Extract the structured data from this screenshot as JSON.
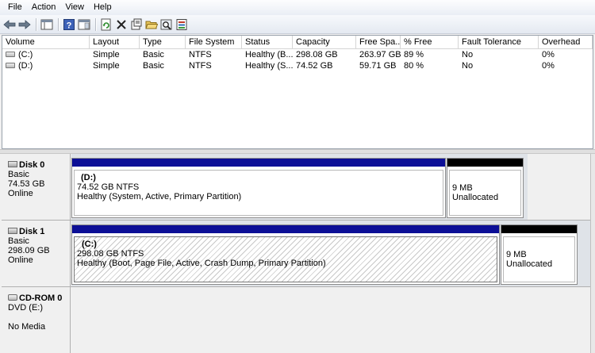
{
  "menu": [
    "File",
    "Action",
    "View",
    "Help"
  ],
  "toolbar": {
    "buttons": [
      "back-icon",
      "forward-icon",
      "show-hide-tree-icon",
      "help-icon",
      "properties-icon",
      "refresh-icon",
      "delete-icon",
      "properties-sheet-icon",
      "open-icon",
      "explore-icon",
      "export-list-icon"
    ]
  },
  "volumes": {
    "columns": [
      "Volume",
      "Layout",
      "Type",
      "File System",
      "Status",
      "Capacity",
      "Free Spa...",
      "% Free",
      "Fault Tolerance",
      "Overhead"
    ],
    "rows": [
      {
        "volume": "(C:)",
        "layout": "Simple",
        "type": "Basic",
        "fs": "NTFS",
        "status": "Healthy (B...",
        "capacity": "298.08 GB",
        "free": "263.97 GB",
        "pct": "89 %",
        "fault": "No",
        "overhead": "0%"
      },
      {
        "volume": "(D:)",
        "layout": "Simple",
        "type": "Basic",
        "fs": "NTFS",
        "status": "Healthy (S...",
        "capacity": "74.52 GB",
        "free": "59.71 GB",
        "pct": "80 %",
        "fault": "No",
        "overhead": "0%"
      }
    ]
  },
  "disks": [
    {
      "name": "Disk 0",
      "type": "Basic",
      "size": "74.53 GB",
      "state": "Online",
      "partitions": [
        {
          "name": "(D:)",
          "size": "74.52 GB NTFS",
          "status": "Healthy (System, Active, Primary Partition)"
        },
        {
          "name": "",
          "size": "9 MB",
          "status": "Unallocated"
        }
      ]
    },
    {
      "name": "Disk 1",
      "type": "Basic",
      "size": "298.09 GB",
      "state": "Online",
      "partitions": [
        {
          "name": "(C:)",
          "size": "298.08 GB NTFS",
          "status": "Healthy (Boot, Page File, Active, Crash Dump, Primary Partition)"
        },
        {
          "name": "",
          "size": "9 MB",
          "status": "Unallocated"
        }
      ]
    },
    {
      "name": "CD-ROM 0",
      "type": "DVD (E:)",
      "size": "",
      "state": "No Media"
    }
  ],
  "colors": {
    "primary_partition": "#0c0f96",
    "unallocated": "#000000",
    "selection_hatch": "#c8c8c8"
  }
}
